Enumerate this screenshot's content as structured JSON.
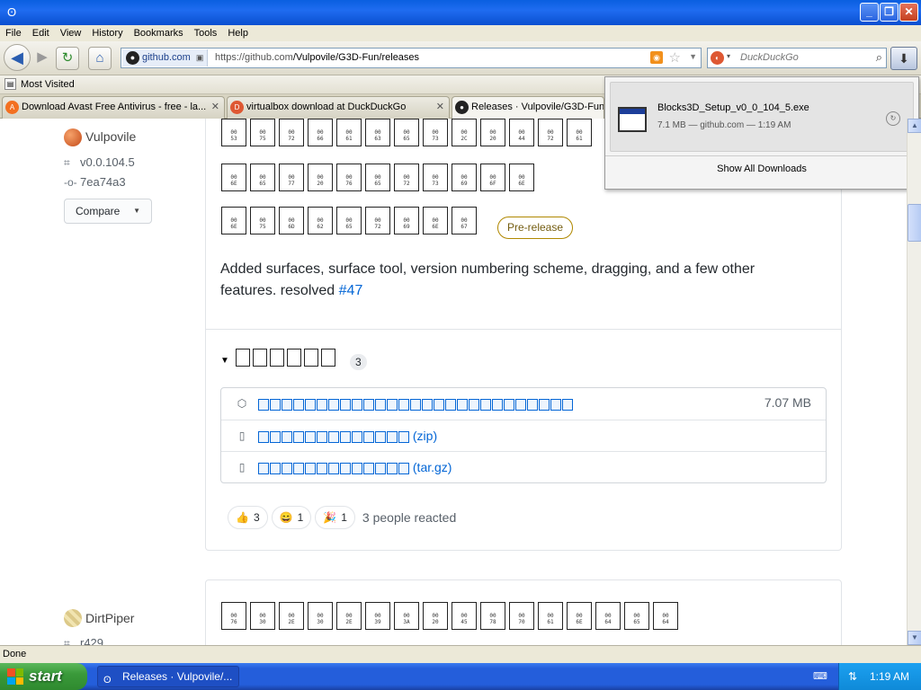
{
  "window": {
    "app_icon": "firefox-raccoon-icon",
    "minimize": "_",
    "maximize": "❐",
    "close": "✕"
  },
  "menu": [
    "File",
    "Edit",
    "View",
    "History",
    "Bookmarks",
    "Tools",
    "Help"
  ],
  "nav": {
    "site_identity": "github.com",
    "url_prefix": "https://github.com",
    "url_path": "/Vulpovile/G3D-Fun/releases",
    "search_placeholder": "DuckDuckGo"
  },
  "bookmarks": {
    "label": "Most Visited"
  },
  "tabs": [
    {
      "title": "Download Avast Free Antivirus - free - la...",
      "icon_color": "#f37021"
    },
    {
      "title": "virtualbox download at DuckDuckGo",
      "icon_color": "#de5833"
    },
    {
      "title": "Releases · Vulpovile/G3D-Fun ·",
      "icon_color": "#222222"
    }
  ],
  "sidebar": {
    "release1": {
      "author": "Vulpovile",
      "tag": "v0.0.104.5",
      "commit": "7ea74a3",
      "compare": "Compare"
    },
    "release2": {
      "author": "DirtPiper",
      "tag": "r429"
    }
  },
  "release": {
    "title_row1_glyph_codes": [
      "53",
      "75",
      "72",
      "66",
      "61",
      "63",
      "65",
      "73",
      "2C",
      "20",
      "44",
      "72",
      "61"
    ],
    "title_row2_glyph_codes": [
      "6E",
      "65",
      "77",
      "20",
      "76",
      "65",
      "72",
      "73",
      "69",
      "6F",
      "6E"
    ],
    "title_row3_glyph_codes": [
      "6E",
      "75",
      "6D",
      "62",
      "65",
      "72",
      "69",
      "6E",
      "67"
    ],
    "badge": "Pre-release",
    "body": "Added surfaces, surface tool, version numbering scheme, dragging, and a few other features. resolved",
    "body_link": "#47",
    "assets_glyph_codes": [
      "41",
      "73",
      "73",
      "65",
      "74",
      "73"
    ],
    "assets_count": "3",
    "assets": [
      {
        "icon": "package-icon",
        "suffix": "",
        "size": "7.07 MB",
        "glyphs": 27
      },
      {
        "icon": "file-zip-icon",
        "suffix": "(zip)",
        "size": "",
        "glyphs": 13
      },
      {
        "icon": "file-zip-icon",
        "suffix": "(tar.gz)",
        "size": "",
        "glyphs": 13
      }
    ],
    "reactions": [
      {
        "emoji": "👍",
        "count": "3"
      },
      {
        "emoji": "😄",
        "count": "1"
      },
      {
        "emoji": "🎉",
        "count": "1"
      }
    ],
    "reacted_text": "3 people reacted"
  },
  "next_release": {
    "title_glyph_codes": [
      "76",
      "30",
      "2E",
      "30",
      "2E",
      "39",
      "3A",
      "20",
      "45",
      "78",
      "70",
      "61",
      "6E",
      "64",
      "65",
      "64"
    ]
  },
  "downloads": {
    "file_name": "Blocks3D_Setup_v0_0_104_5.exe",
    "meta": "7.1 MB — github.com — 1:19 AM",
    "show_all": "Show All Downloads"
  },
  "status": "Done",
  "taskbar": {
    "start": "start",
    "item": "Releases · Vulpovile/...",
    "clock": "1:19 AM"
  },
  "colors": {
    "link": "#0366d6",
    "prerelease": "#b08800",
    "xp_blue": "#245edb",
    "start_green": "#3a9a3a"
  }
}
